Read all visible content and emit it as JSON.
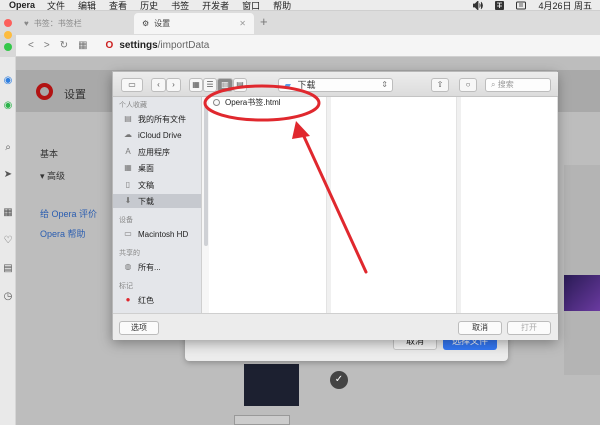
{
  "menubar": {
    "app": "Opera",
    "items": [
      "文件",
      "编辑",
      "查看",
      "历史",
      "书签",
      "开发者",
      "窗口",
      "帮助"
    ],
    "date": "4月26日 周五"
  },
  "browser": {
    "tabs": [
      {
        "label": "书签：书签栏",
        "close": ""
      },
      {
        "label": "设置",
        "close": "✕"
      }
    ],
    "new_tab": "+",
    "url_path": "settings",
    "url_rest": "/importData"
  },
  "page": {
    "title": "设置",
    "nav": [
      "基本",
      "▾  高级"
    ],
    "links": [
      "给 Opera 评价",
      "Opera 帮助"
    ],
    "under_dialog": {
      "cancel": "取消",
      "choose": "选择文件"
    },
    "check": "✓"
  },
  "sheet": {
    "location": "下载",
    "search_placeholder": "搜索",
    "sidebar": {
      "sections": {
        "favorites": "个人收藏",
        "devices": "设备",
        "shared": "共享的",
        "tags": "标记"
      },
      "items": {
        "all_files": "我的所有文件",
        "icloud": "iCloud Drive",
        "apps": "应用程序",
        "desktop": "桌面",
        "documents": "文稿",
        "downloads": "下载",
        "mac_hd": "Macintosh HD",
        "all": "所有...",
        "red": "红色"
      }
    },
    "file": "Opera书签.html",
    "options_button": "选项",
    "cancel_button": "取消",
    "open_button": "打开"
  },
  "colors": {
    "annotation": "#e0282e",
    "accent": "#3478f6",
    "opera_red": "#cc1e1e"
  }
}
